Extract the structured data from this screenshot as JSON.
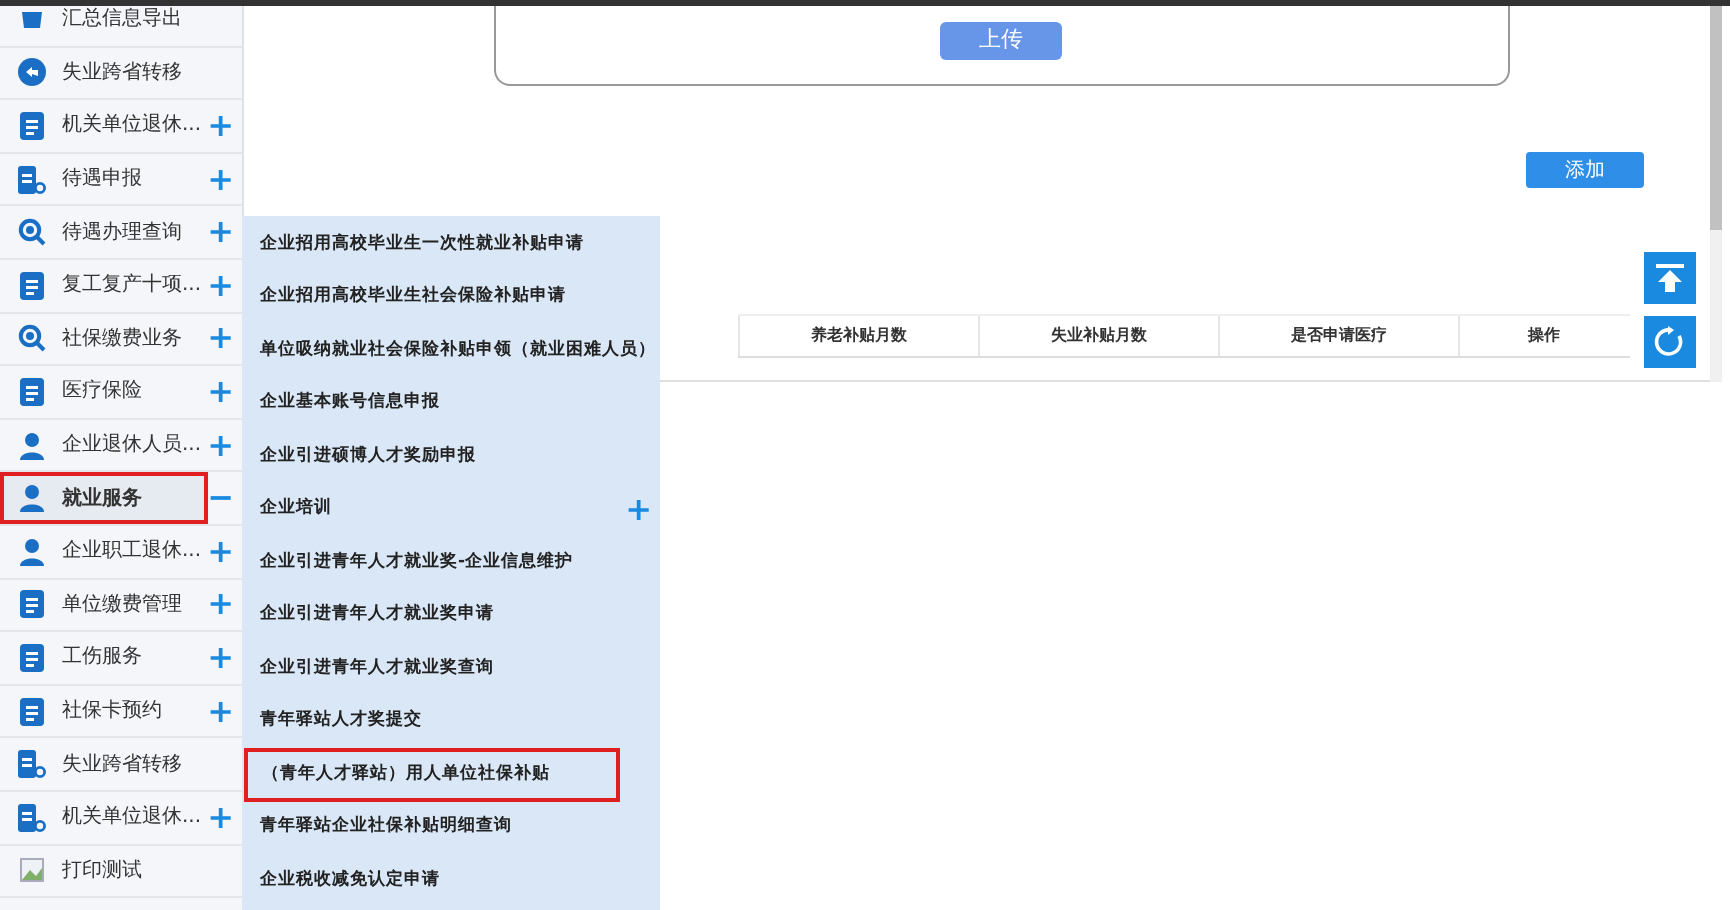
{
  "sidebar": {
    "items": [
      {
        "label": "汇总信息导出",
        "kind": "bin",
        "selected": false,
        "highlighted": false
      },
      {
        "label": "失业跨省转移",
        "kind": "circle",
        "selected": false,
        "highlighted": false
      },
      {
        "label": "机关单位退休...",
        "kind": "doc",
        "selected": false,
        "highlighted": false,
        "toggle": "+"
      },
      {
        "label": "待遇申报",
        "kind": "docsearch",
        "selected": false,
        "highlighted": false,
        "toggle": "+"
      },
      {
        "label": "待遇办理查询",
        "kind": "search",
        "selected": false,
        "highlighted": false,
        "toggle": "+"
      },
      {
        "label": "复工复产十项...",
        "kind": "doc",
        "selected": false,
        "highlighted": false,
        "toggle": "+"
      },
      {
        "label": "社保缴费业务",
        "kind": "search",
        "selected": false,
        "highlighted": false,
        "toggle": "+"
      },
      {
        "label": "医疗保险",
        "kind": "doc",
        "selected": false,
        "highlighted": false,
        "toggle": "+"
      },
      {
        "label": "企业退休人员...",
        "kind": "person",
        "selected": false,
        "highlighted": false,
        "toggle": "+"
      },
      {
        "label": "就业服务",
        "kind": "person",
        "selected": true,
        "highlighted": true,
        "toggle": "−"
      },
      {
        "label": "企业职工退休...",
        "kind": "person",
        "selected": false,
        "highlighted": false,
        "toggle": "+"
      },
      {
        "label": "单位缴费管理",
        "kind": "doc",
        "selected": false,
        "highlighted": false,
        "toggle": "+"
      },
      {
        "label": "工伤服务",
        "kind": "doc",
        "selected": false,
        "highlighted": false,
        "toggle": "+"
      },
      {
        "label": "社保卡预约",
        "kind": "doc",
        "selected": false,
        "highlighted": false,
        "toggle": "+"
      },
      {
        "label": "失业跨省转移",
        "kind": "docsearch",
        "selected": false,
        "highlighted": false
      },
      {
        "label": "机关单位退休...",
        "kind": "docsearch",
        "selected": false,
        "highlighted": false,
        "toggle": "+"
      },
      {
        "label": "打印测试",
        "kind": "image",
        "selected": false,
        "highlighted": false
      }
    ]
  },
  "submenu": {
    "items": [
      {
        "label": "企业招用高校毕业生一次性就业补贴申请",
        "highlighted": false
      },
      {
        "label": "企业招用高校毕业生社会保险补贴申请",
        "highlighted": false
      },
      {
        "label": "单位吸纳就业社会保险补贴申领（就业困难人员）",
        "highlighted": false
      },
      {
        "label": "企业基本账号信息申报",
        "highlighted": false
      },
      {
        "label": "企业引进硕博人才奖励申报",
        "highlighted": false
      },
      {
        "label": "企业培训",
        "highlighted": false,
        "toggle": "+"
      },
      {
        "label": "企业引进青年人才就业奖-企业信息维护",
        "highlighted": false
      },
      {
        "label": "企业引进青年人才就业奖申请",
        "highlighted": false
      },
      {
        "label": "企业引进青年人才就业奖查询",
        "highlighted": false
      },
      {
        "label": "青年驿站人才奖提交",
        "highlighted": false
      },
      {
        "label": "（青年人才驿站）用人单位社保补贴",
        "highlighted": true
      },
      {
        "label": "青年驿站企业社保补贴明细查询",
        "highlighted": false
      },
      {
        "label": "企业税收减免认定申请",
        "highlighted": false
      }
    ]
  },
  "upload_button": "上传",
  "add_button": "添加",
  "table": {
    "columns": [
      "养老补贴月数",
      "失业补贴月数",
      "是否申请医疗",
      "操作"
    ]
  }
}
